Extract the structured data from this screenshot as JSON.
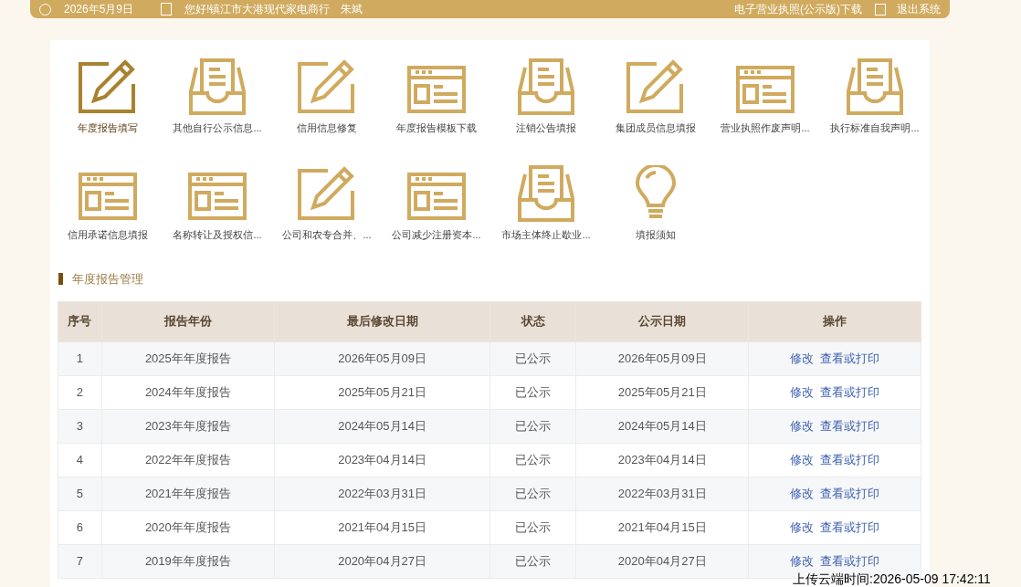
{
  "top_bar": {
    "date": "2026年5月9日",
    "greeting": "您好!镇江市大港现代家电商行　朱斌",
    "download_link": "电子营业执照(公示版)下载",
    "logout": "退出系统"
  },
  "shortcuts": [
    {
      "label": "年度报告填写",
      "kind": "pen",
      "selected": true
    },
    {
      "label": "其他自行公示信息...",
      "kind": "tray",
      "selected": false
    },
    {
      "label": "信用信息修复",
      "kind": "pen",
      "selected": false
    },
    {
      "label": "年度报告模板下载",
      "kind": "form",
      "selected": false
    },
    {
      "label": "注销公告填报",
      "kind": "tray",
      "selected": false
    },
    {
      "label": "集团成员信息填报",
      "kind": "pen",
      "selected": false
    },
    {
      "label": "营业执照作废声明...",
      "kind": "form",
      "selected": false
    },
    {
      "label": "执行标准自我声明...",
      "kind": "tray",
      "selected": false
    },
    {
      "label": "信用承诺信息填报",
      "kind": "form",
      "selected": false
    },
    {
      "label": "名称转让及授权信...",
      "kind": "form",
      "selected": false
    },
    {
      "label": "公司和农专合并、...",
      "kind": "pen",
      "selected": false
    },
    {
      "label": "公司减少注册资本...",
      "kind": "form",
      "selected": false
    },
    {
      "label": "市场主体终止歇业...",
      "kind": "tray",
      "selected": false
    },
    {
      "label": "填报须知",
      "kind": "bulb",
      "selected": false
    }
  ],
  "section_title": "年度报告管理",
  "table": {
    "columns": [
      "序号",
      "报告年份",
      "最后修改日期",
      "状态",
      "公示日期",
      "操作"
    ],
    "rows": [
      {
        "cells": [
          "1",
          "2025年年度报告",
          "2026年05月09日",
          "已公示",
          "2026年05月09日"
        ],
        "actions": [
          "修改",
          "查看或打印"
        ]
      },
      {
        "cells": [
          "2",
          "2024年年度报告",
          "2025年05月21日",
          "已公示",
          "2025年05月21日"
        ],
        "actions": [
          "修改",
          "查看或打印"
        ]
      },
      {
        "cells": [
          "3",
          "2023年年度报告",
          "2024年05月14日",
          "已公示",
          "2024年05月14日"
        ],
        "actions": [
          "修改",
          "查看或打印"
        ]
      },
      {
        "cells": [
          "4",
          "2022年年度报告",
          "2023年04月14日",
          "已公示",
          "2023年04月14日"
        ],
        "actions": [
          "修改",
          "查看或打印"
        ]
      },
      {
        "cells": [
          "5",
          "2021年年度报告",
          "2022年03月31日",
          "已公示",
          "2022年03月31日"
        ],
        "actions": [
          "修改",
          "查看或打印"
        ]
      },
      {
        "cells": [
          "6",
          "2020年年度报告",
          "2021年04月15日",
          "已公示",
          "2021年04月15日"
        ],
        "actions": [
          "修改",
          "查看或打印"
        ]
      },
      {
        "cells": [
          "7",
          "2019年年度报告",
          "2020年04月27日",
          "已公示",
          "2020年04月27日"
        ],
        "actions": [
          "修改",
          "查看或打印"
        ]
      }
    ]
  },
  "upload_time": "上传云端时间:2026-05-09 17:42:11"
}
